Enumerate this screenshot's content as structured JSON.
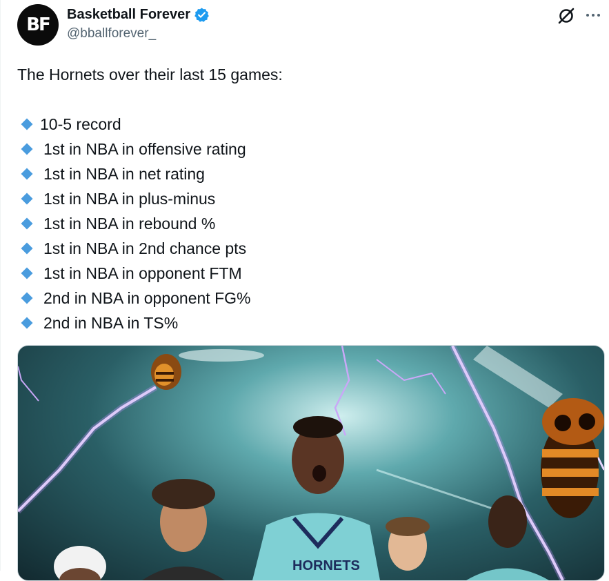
{
  "author": {
    "display_name": "Basketball Forever",
    "handle": "@bballforever_",
    "avatar_text": "BF",
    "verified": true,
    "verified_color": "#1d9bf0"
  },
  "tweet": {
    "intro": "The Hornets over their last 15 games:",
    "bullet_icon": "small-blue-diamond",
    "bullet_color": "#4a9cde",
    "items": [
      "10-5 record",
      "1st in NBA in offensive rating",
      "1st in NBA in net rating",
      "1st in NBA in plus-minus",
      "1st in NBA in rebound %",
      "1st in NBA in 2nd chance pts",
      "1st in NBA in opponent FTM",
      "2nd in NBA in opponent FG%",
      "2nd in NBA in TS%"
    ]
  },
  "header_actions": [
    {
      "icon": "grok-icon"
    },
    {
      "icon": "more-horizontal-icon"
    }
  ],
  "media": {
    "kind": "image",
    "jersey_text": "HORNETS"
  }
}
